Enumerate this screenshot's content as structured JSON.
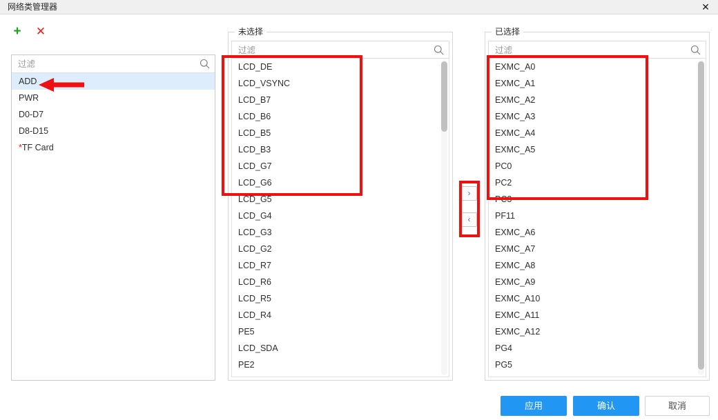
{
  "window": {
    "title": "网络类管理器",
    "close_label": "✕"
  },
  "toolbar": {
    "add_icon": "plus-icon",
    "add_label": "+",
    "delete_icon": "cross-icon",
    "delete_label": "✕"
  },
  "left_panel": {
    "filter_placeholder": "过滤",
    "filter_value": "",
    "items": [
      {
        "label": "ADD",
        "selected": true,
        "required": false
      },
      {
        "label": "PWR",
        "selected": false,
        "required": false
      },
      {
        "label": "D0-D7",
        "selected": false,
        "required": false
      },
      {
        "label": "D8-D15",
        "selected": false,
        "required": false
      },
      {
        "label": "TF Card",
        "selected": false,
        "required": true
      }
    ]
  },
  "unselected_panel": {
    "legend": "未选择",
    "filter_placeholder": "过滤",
    "filter_value": "",
    "items": [
      "LCD_DE",
      "LCD_VSYNC",
      "LCD_B7",
      "LCD_B6",
      "LCD_B5",
      "LCD_B3",
      "LCD_G7",
      "LCD_G6",
      "LCD_G5",
      "LCD_G4",
      "LCD_G3",
      "LCD_G2",
      "LCD_R7",
      "LCD_R6",
      "LCD_R5",
      "LCD_R4",
      "PE5",
      "LCD_SDA",
      "PE2"
    ]
  },
  "selected_panel": {
    "legend": "已选择",
    "filter_placeholder": "过滤",
    "filter_value": "",
    "items": [
      "EXMC_A0",
      "EXMC_A1",
      "EXMC_A2",
      "EXMC_A3",
      "EXMC_A4",
      "EXMC_A5",
      "PC0",
      "PC2",
      "PC3",
      "PF11",
      "EXMC_A6",
      "EXMC_A7",
      "EXMC_A8",
      "EXMC_A9",
      "EXMC_A10",
      "EXMC_A11",
      "EXMC_A12",
      "PG4",
      "PG5"
    ]
  },
  "transfer": {
    "move_right_label": "›",
    "move_left_label": "‹"
  },
  "footer": {
    "apply_label": "应用",
    "confirm_label": "确认",
    "cancel_label": "取消"
  },
  "annotations": {
    "color": "#ee1111",
    "arrow_direction": "left",
    "boxes": [
      "unselected-list-top",
      "selected-list-top",
      "transfer-buttons"
    ]
  },
  "colors": {
    "accent": "#2196f3",
    "selection": "#ddedfb",
    "annotation": "#ee1111",
    "add_icon": "#19a319",
    "delete_icon": "#ee1c1c"
  }
}
